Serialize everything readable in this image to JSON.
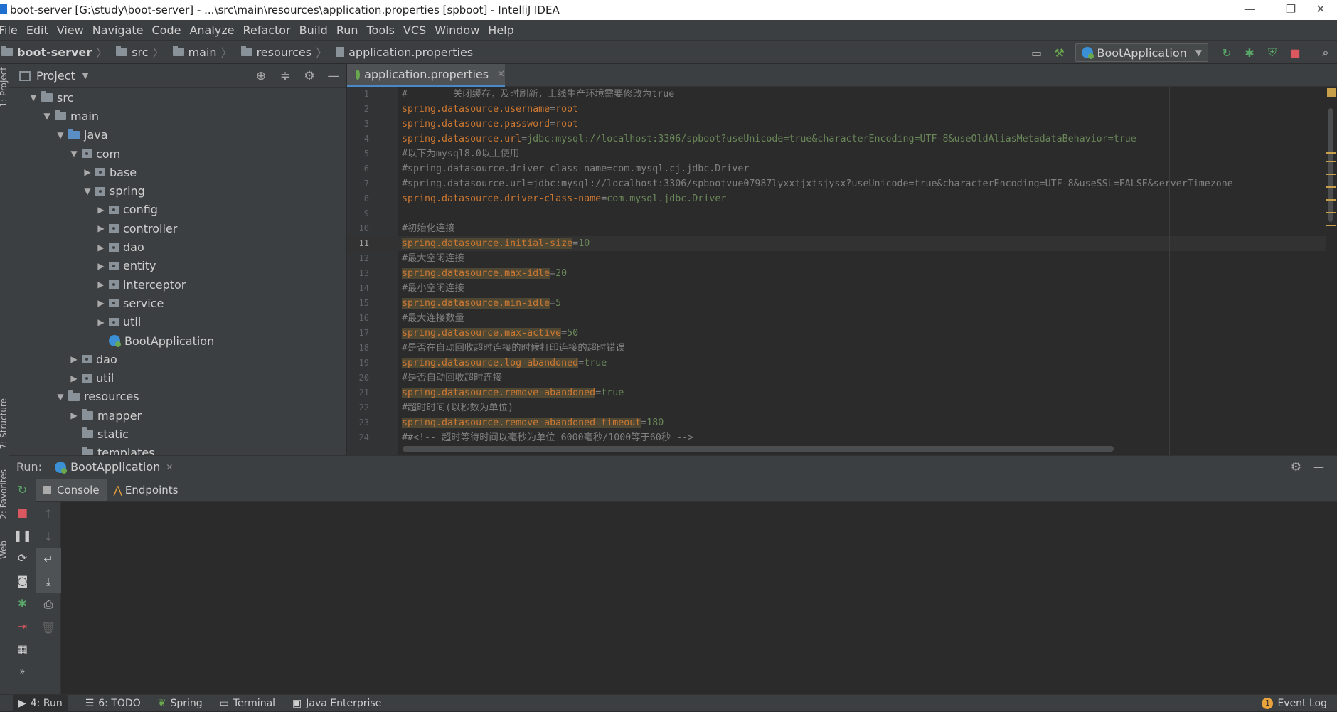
{
  "window": {
    "title": "boot-server [G:\\study\\boot-server] - ...\\src\\main\\resources\\application.properties [spboot] - IntelliJ IDEA",
    "controls": [
      "—",
      "❐",
      "✕"
    ]
  },
  "menu": [
    "File",
    "Edit",
    "View",
    "Navigate",
    "Code",
    "Analyze",
    "Refactor",
    "Build",
    "Run",
    "Tools",
    "VCS",
    "Window",
    "Help"
  ],
  "breadcrumb": [
    "boot-server",
    "src",
    "main",
    "resources",
    "application.properties"
  ],
  "run_config": "BootApplication",
  "project_panel": {
    "title": "Project",
    "tree": [
      {
        "label": "src",
        "depth": 1,
        "arrow": "▼",
        "icon": "folder"
      },
      {
        "label": "main",
        "depth": 2,
        "arrow": "▼",
        "icon": "folder"
      },
      {
        "label": "java",
        "depth": 3,
        "arrow": "▼",
        "icon": "folder-blue"
      },
      {
        "label": "com",
        "depth": 4,
        "arrow": "▼",
        "icon": "package"
      },
      {
        "label": "base",
        "depth": 5,
        "arrow": "▶",
        "icon": "package"
      },
      {
        "label": "spring",
        "depth": 5,
        "arrow": "▼",
        "icon": "package"
      },
      {
        "label": "config",
        "depth": 6,
        "arrow": "▶",
        "icon": "package"
      },
      {
        "label": "controller",
        "depth": 6,
        "arrow": "▶",
        "icon": "package"
      },
      {
        "label": "dao",
        "depth": 6,
        "arrow": "▶",
        "icon": "package"
      },
      {
        "label": "entity",
        "depth": 6,
        "arrow": "▶",
        "icon": "package"
      },
      {
        "label": "interceptor",
        "depth": 6,
        "arrow": "▶",
        "icon": "package"
      },
      {
        "label": "service",
        "depth": 6,
        "arrow": "▶",
        "icon": "package"
      },
      {
        "label": "util",
        "depth": 6,
        "arrow": "▶",
        "icon": "package"
      },
      {
        "label": "BootApplication",
        "depth": 6,
        "arrow": "",
        "icon": "boot"
      },
      {
        "label": "dao",
        "depth": 4,
        "arrow": "▶",
        "icon": "package"
      },
      {
        "label": "util",
        "depth": 4,
        "arrow": "▶",
        "icon": "package"
      },
      {
        "label": "resources",
        "depth": 3,
        "arrow": "▼",
        "icon": "folder-res"
      },
      {
        "label": "mapper",
        "depth": 4,
        "arrow": "▶",
        "icon": "folder"
      },
      {
        "label": "static",
        "depth": 4,
        "arrow": "",
        "icon": "folder"
      },
      {
        "label": "templates",
        "depth": 4,
        "arrow": "",
        "icon": "folder"
      }
    ]
  },
  "editor": {
    "tab": "application.properties",
    "current_line": 11,
    "lines": [
      {
        "n": 1,
        "parts": [
          {
            "t": "#        关闭缓存，及时刷新，上线生产环境需要修改为true",
            "c": "c"
          }
        ]
      },
      {
        "n": 2,
        "parts": [
          {
            "t": "spring.datasource.username",
            "c": "k"
          },
          {
            "t": "=",
            "c": "c"
          },
          {
            "t": "root",
            "c": "k"
          }
        ]
      },
      {
        "n": 3,
        "parts": [
          {
            "t": "spring.datasource.password",
            "c": "k"
          },
          {
            "t": "=",
            "c": "c"
          },
          {
            "t": "root",
            "c": "k"
          }
        ]
      },
      {
        "n": 4,
        "parts": [
          {
            "t": "spring.datasource.url",
            "c": "k"
          },
          {
            "t": "=",
            "c": "c"
          },
          {
            "t": "jdbc:mysql://localhost:3306/spboot?useUnicode=true&characterEncoding=UTF-8&useOldAliasMetadataBehavior=true",
            "c": "v"
          }
        ]
      },
      {
        "n": 5,
        "parts": [
          {
            "t": "#以下为mysql8.0以上使用",
            "c": "c"
          }
        ]
      },
      {
        "n": 6,
        "parts": [
          {
            "t": "#spring.datasource.driver-class-name=com.mysql.cj.jdbc.Driver",
            "c": "c"
          }
        ]
      },
      {
        "n": 7,
        "parts": [
          {
            "t": "#spring.datasource.url=jdbc:mysql://localhost:3306/spbootvue07987lyxxtjxtsjysx?useUnicode=true&characterEncoding=UTF-8&useSSL=FALSE&serverTimezone",
            "c": "c"
          }
        ]
      },
      {
        "n": 8,
        "parts": [
          {
            "t": "spring.datasource.driver-class-name",
            "c": "k"
          },
          {
            "t": "=",
            "c": "c"
          },
          {
            "t": "com.mysql.jdbc.Driver",
            "c": "v"
          }
        ]
      },
      {
        "n": 9,
        "parts": [
          {
            "t": "",
            "c": "c"
          }
        ]
      },
      {
        "n": 10,
        "parts": [
          {
            "t": "#初始化连接",
            "c": "c"
          }
        ]
      },
      {
        "n": 11,
        "parts": [
          {
            "t": "spring.datasource.initial-size",
            "c": "k hl"
          },
          {
            "t": "=",
            "c": "c"
          },
          {
            "t": "10",
            "c": "v"
          }
        ]
      },
      {
        "n": 12,
        "parts": [
          {
            "t": "#最大空闲连接",
            "c": "c"
          }
        ]
      },
      {
        "n": 13,
        "parts": [
          {
            "t": "spring.datasource.max-idle",
            "c": "k hl"
          },
          {
            "t": "=",
            "c": "c"
          },
          {
            "t": "20",
            "c": "v"
          }
        ]
      },
      {
        "n": 14,
        "parts": [
          {
            "t": "#最小空闲连接",
            "c": "c"
          }
        ]
      },
      {
        "n": 15,
        "parts": [
          {
            "t": "spring.datasource.min-idle",
            "c": "k hl"
          },
          {
            "t": "=",
            "c": "c"
          },
          {
            "t": "5",
            "c": "v"
          }
        ]
      },
      {
        "n": 16,
        "parts": [
          {
            "t": "#最大连接数量",
            "c": "c"
          }
        ]
      },
      {
        "n": 17,
        "parts": [
          {
            "t": "spring.datasource.max-active",
            "c": "k hl"
          },
          {
            "t": "=",
            "c": "c"
          },
          {
            "t": "50",
            "c": "v"
          }
        ]
      },
      {
        "n": 18,
        "parts": [
          {
            "t": "#是否在自动回收超时连接的时候打印连接的超时错误",
            "c": "c"
          }
        ]
      },
      {
        "n": 19,
        "parts": [
          {
            "t": "spring.datasource.log-abandoned",
            "c": "k hl"
          },
          {
            "t": "=",
            "c": "c"
          },
          {
            "t": "true",
            "c": "v"
          }
        ]
      },
      {
        "n": 20,
        "parts": [
          {
            "t": "#是否自动回收超时连接",
            "c": "c"
          }
        ]
      },
      {
        "n": 21,
        "parts": [
          {
            "t": "spring.datasource.remove-abandoned",
            "c": "k hl"
          },
          {
            "t": "=",
            "c": "c"
          },
          {
            "t": "true",
            "c": "v"
          }
        ]
      },
      {
        "n": 22,
        "parts": [
          {
            "t": "#超时时间(以秒数为单位)",
            "c": "c"
          }
        ]
      },
      {
        "n": 23,
        "parts": [
          {
            "t": "spring.datasource.remove-abandoned-timeout",
            "c": "k hl"
          },
          {
            "t": "=",
            "c": "c"
          },
          {
            "t": "180",
            "c": "v"
          }
        ]
      },
      {
        "n": 24,
        "parts": [
          {
            "t": "##<!-- 超时等待时间以毫秒为单位 6000毫秒/1000等于60秒 -->",
            "c": "c"
          }
        ]
      }
    ]
  },
  "run_panel": {
    "label": "Run:",
    "tab": "BootApplication",
    "subtabs": [
      "Console",
      "Endpoints"
    ]
  },
  "side_tabs": [
    "1: Project",
    "7: Structure",
    "2: Favorites",
    "Web"
  ],
  "status_tabs": [
    "4: Run",
    "6: TODO",
    "Spring",
    "Terminal",
    "Java Enterprise"
  ],
  "event_log": "Event Log",
  "event_count": "1"
}
